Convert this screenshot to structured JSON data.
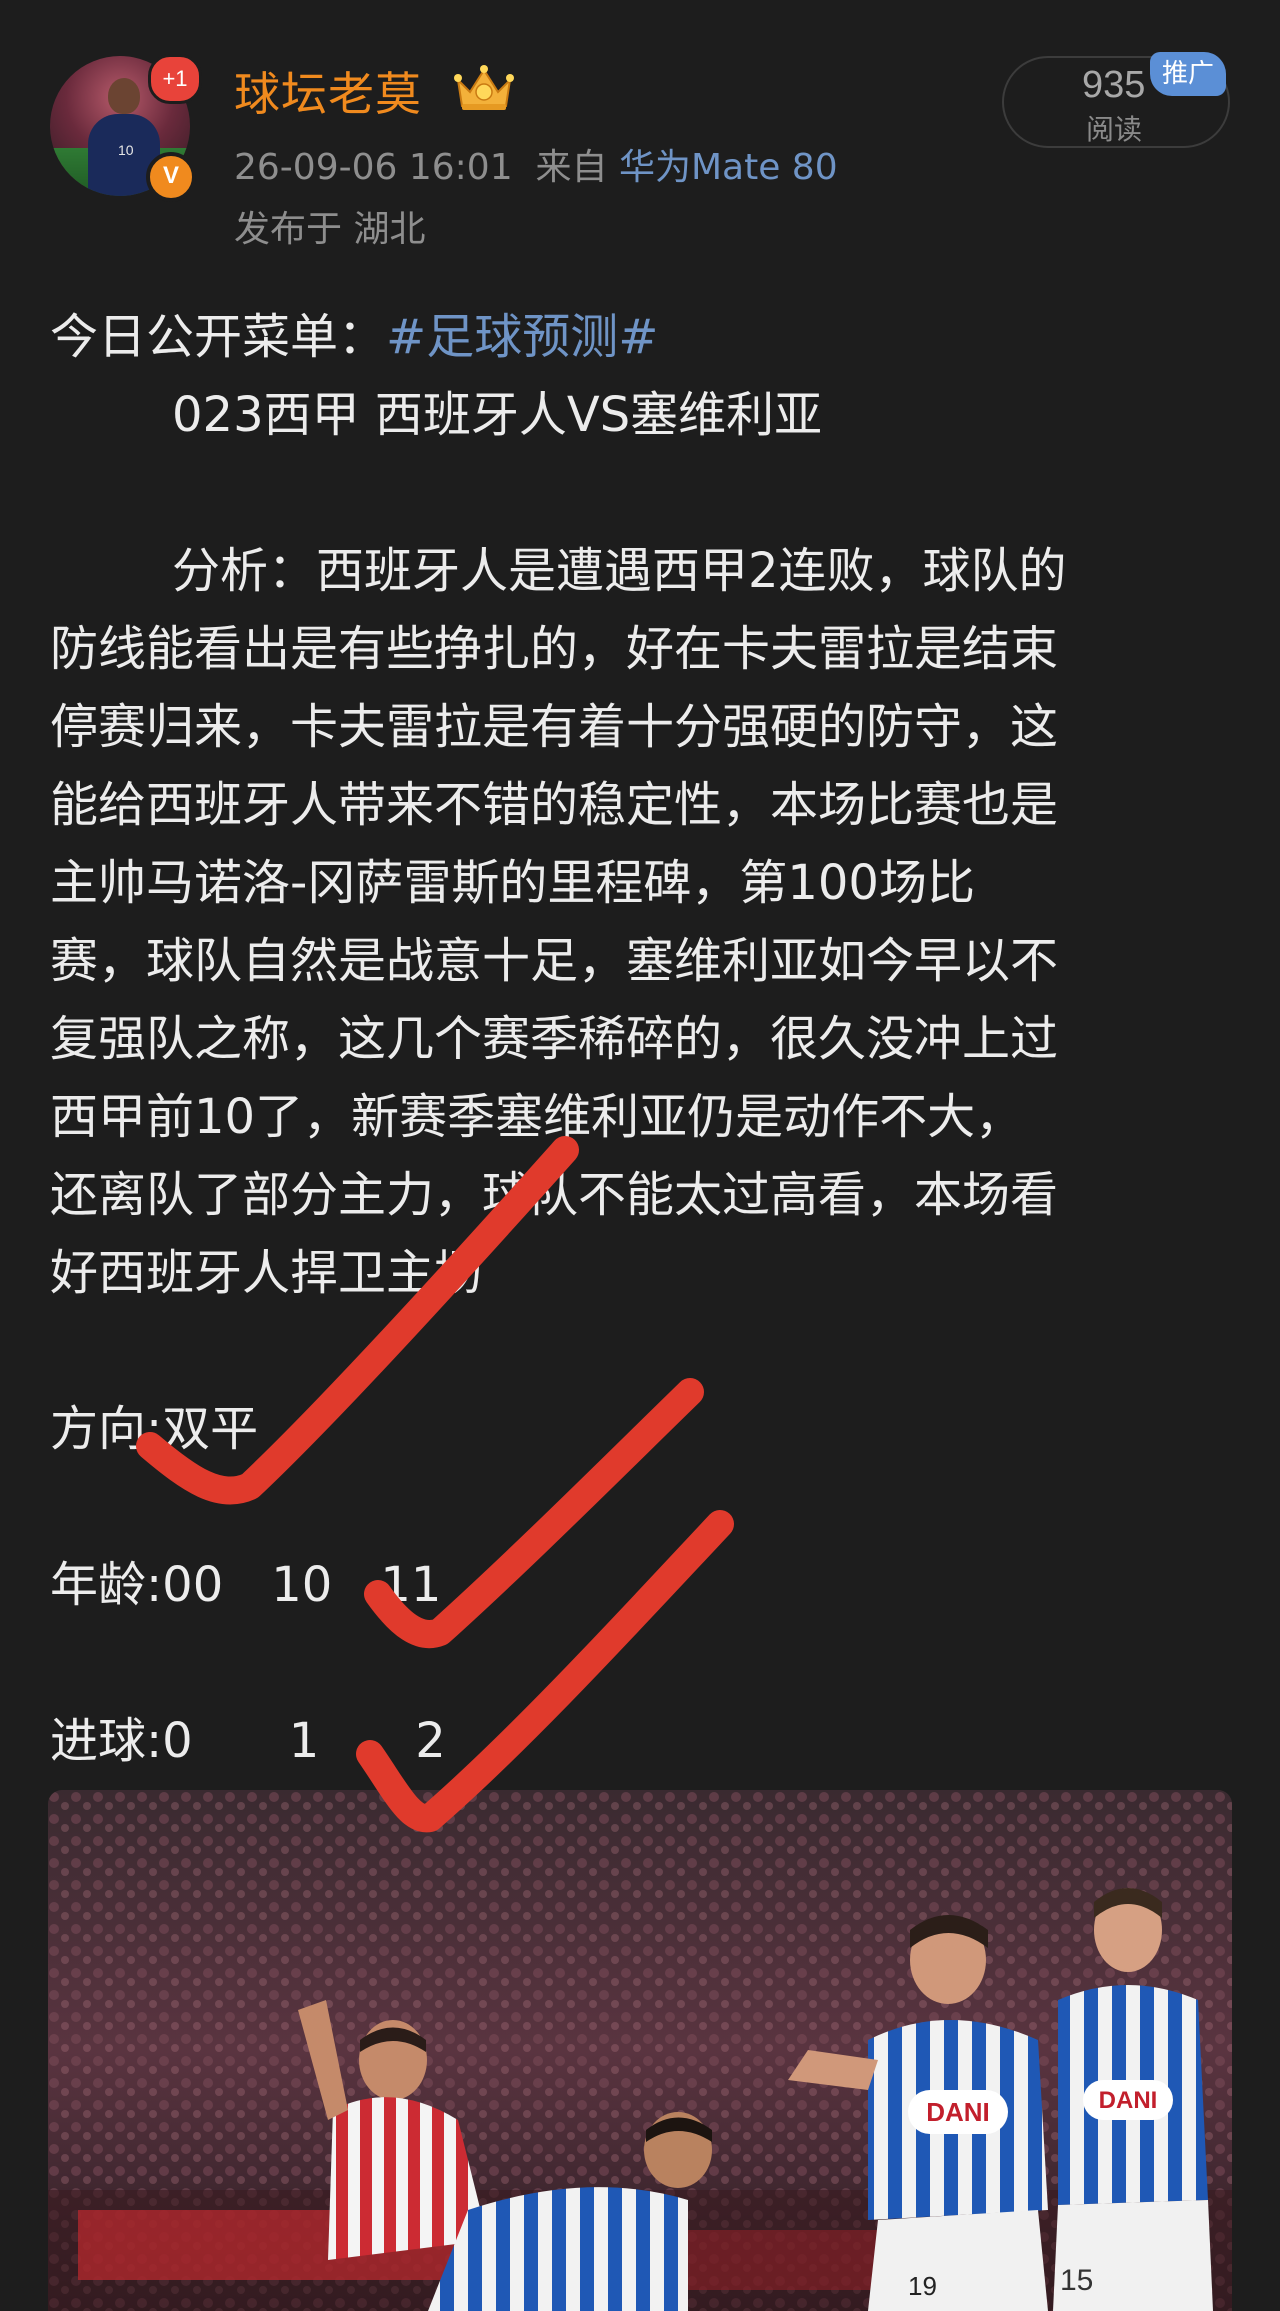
{
  "header": {
    "username": "球坛老莫",
    "plus_badge": "+1",
    "verified_badge": "V",
    "jersey_number": "10",
    "timestamp": "26-09-06 16:01",
    "source_prefix": "来自",
    "device": "华为Mate 80",
    "location": "发布于 湖北",
    "read_count": "935",
    "read_label": "阅读",
    "promo_tag": "推广"
  },
  "post": {
    "intro_prefix": "今日公开菜单：",
    "hashtag": "#足球预测#",
    "match_line": "023西甲 西班牙人VS塞维利亚",
    "analysis_lines": [
      "分析：西班牙人是遭遇西甲2连败，球队的",
      "防线能看出是有些挣扎的，好在卡夫雷拉是结束",
      "停赛归来，卡夫雷拉是有着十分强硬的防守，这",
      "能给西班牙人带来不错的稳定性，本场比赛也是",
      "主帅马诺洛-冈萨雷斯的里程碑，第100场比",
      "赛，球队自然是战意十足，塞维利亚如今早以不",
      "复强队之称，这几个赛季稀碎的，很久没冲上过",
      "西甲前10了，新赛季塞维利亚仍是动作不大，",
      "还离队了部分主力，球队不能太过高看，本场看",
      "好西班牙人捍卫主场"
    ],
    "direction": "方向:双平",
    "age": "年龄:00　10　11",
    "goals": "进球:0　　1　　2"
  },
  "photo": {
    "sponsor_text": "DANI",
    "player_numbers": [
      "15",
      "19"
    ]
  },
  "colors": {
    "background": "#1d1d1d",
    "username": "#f08a1e",
    "link": "#6f94c6",
    "check_marks": "#e03a2c",
    "espanyol_blue": "#1f58b5",
    "atletico_red": "#cc2b33"
  }
}
